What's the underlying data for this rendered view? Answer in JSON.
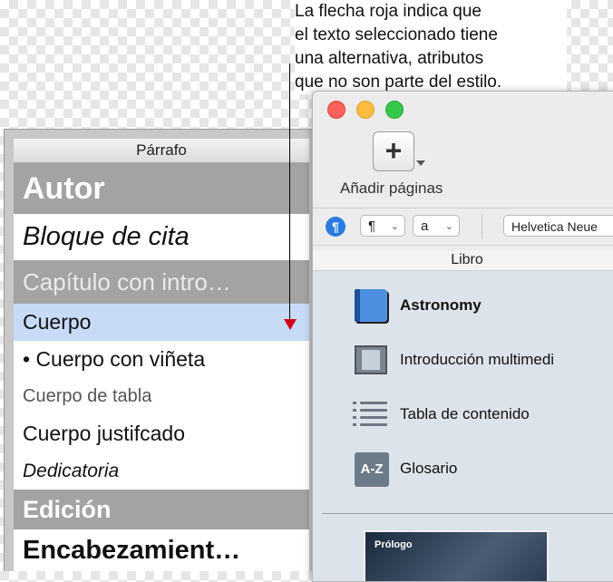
{
  "annotation": {
    "lines": [
      "La flecha roja indica que",
      "el texto seleccionado tiene",
      "una alternativa, atributos",
      "que no son parte del estilo."
    ]
  },
  "paragraph_panel": {
    "title": "Párrafo",
    "styles": [
      "Autor",
      "Bloque de cita",
      "Capítulo con intro…",
      "Cuerpo",
      "• Cuerpo con viñeta",
      "Cuerpo de tabla",
      "Cuerpo justifcado",
      "Dedicatoria",
      "Edición",
      "Encabezamient…"
    ],
    "selected": "Cuerpo",
    "override_indicator_color": "#d0021b"
  },
  "app_window": {
    "toolbar": {
      "add_pages_label": "Añadir páginas",
      "add_symbol": "+"
    },
    "format_bar": {
      "paragraph_icon": "¶",
      "paragraph_popup": "¶",
      "character_popup": "a",
      "font_popup": "Helvetica Neue"
    },
    "libro": {
      "title": "Libro",
      "items": [
        {
          "label": "Astronomy",
          "icon": "book-icon"
        },
        {
          "label": "Introducción multimedi",
          "icon": "film-icon"
        },
        {
          "label": "Tabla de contenido",
          "icon": "list-icon"
        },
        {
          "label": "Glosario",
          "icon": "az-icon"
        }
      ],
      "az_text": "A-Z",
      "thumbnail_label": "Prólogo"
    },
    "colors": {
      "accent": "#2a7cde",
      "selection": "#c7dbf7"
    }
  }
}
